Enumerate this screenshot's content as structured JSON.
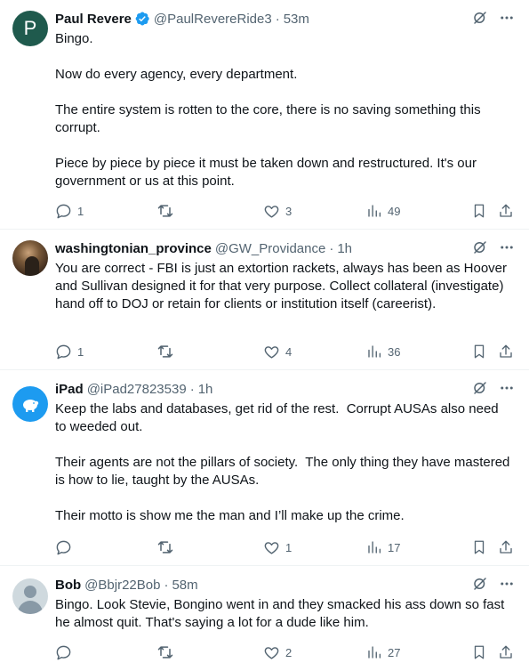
{
  "colors": {
    "accent": "#1d9bf0",
    "muted": "#536471",
    "text": "#0f1419",
    "avatar_p": "#1f5a4d"
  },
  "tweets": [
    {
      "avatar": "P",
      "name": "Paul Revere",
      "verified": true,
      "handle": "@PaulRevereRide3",
      "time": "53m",
      "text": "Bingo.\n\nNow do every agency, every department.\n\nThe entire system is rotten to the core, there is no saving something this corrupt.\n\nPiece by piece by piece it must be taken down and restructured. It's our government or us at this point.",
      "replies": "1",
      "reposts": "",
      "likes": "3",
      "views": "49"
    },
    {
      "avatar": "",
      "name": "washingtonian_province",
      "verified": false,
      "handle": "@GW_Providance",
      "time": "1h",
      "text": "You are correct - FBI is just an extortion rackets, always has been as Hoover and Sullivan designed it for that very purpose. Collect collateral (investigate) hand off to DOJ or retain for clients or institution itself (careerist).",
      "replies": "1",
      "reposts": "",
      "likes": "4",
      "views": "36"
    },
    {
      "avatar": "",
      "name": "iPad",
      "verified": false,
      "handle": "@iPad27823539",
      "time": "1h",
      "text": "Keep the labs and databases, get rid of the rest.  Corrupt AUSAs also need to weeded out.\n\nTheir agents are not the pillars of society.  The only thing they have mastered is how to lie, taught by the AUSAs.\n\nTheir motto is show me the man and I’ll make up the crime.",
      "replies": "",
      "reposts": "",
      "likes": "1",
      "views": "17"
    },
    {
      "avatar": "",
      "name": "Bob",
      "verified": false,
      "handle": "@Bbjr22Bob",
      "time": "58m",
      "text": "Bingo. Look Stevie, Bongino went in and they smacked his ass down so fast he almost quit. That's saying a lot for a dude like him.",
      "replies": "",
      "reposts": "",
      "likes": "2",
      "views": "27"
    }
  ]
}
